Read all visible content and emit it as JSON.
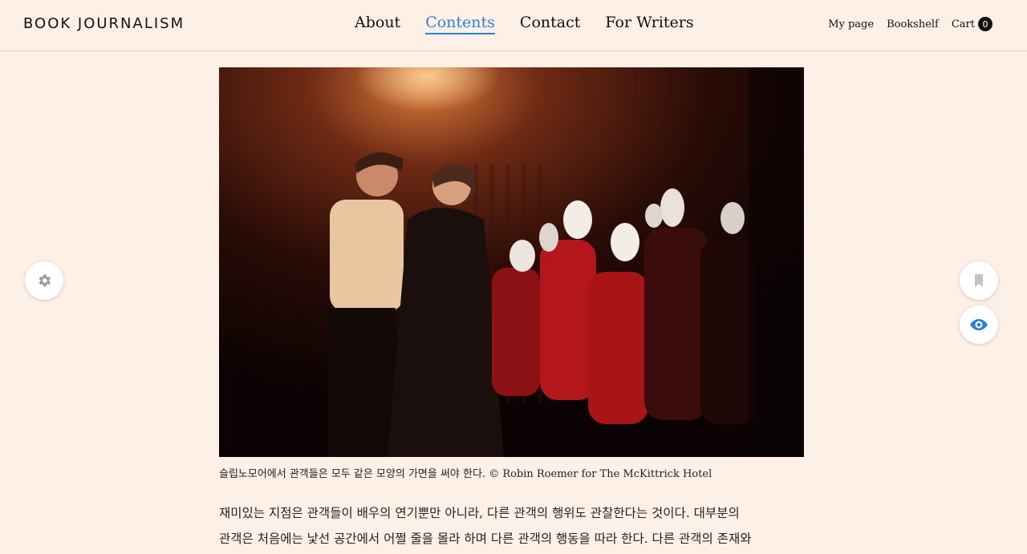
{
  "header": {
    "logo": "BOOK JOURNALISM",
    "nav": [
      {
        "label": "About"
      },
      {
        "label": "Contents",
        "active": true
      },
      {
        "label": "Contact"
      },
      {
        "label": "For Writers"
      }
    ],
    "util": {
      "mypage": "My page",
      "bookshelf": "Bookshelf",
      "cart_label": "Cart",
      "cart_count": "0"
    }
  },
  "article": {
    "caption": "슬립노모어에서 관객들은 모두 같은 모양의 가면을 써야 한다. © Robin Roemer for The McKittrick Hotel",
    "paragraph_lines": [
      "재미있는 지점은 관객들이 배우의 연기뿐만 아니라, 다른 관객의 행위도 관찰한다는 것이다. 대부분의",
      "관객은 처음에는 낯선 공간에서 어쩔 줄을 몰라 하며 다른 관객의 행동을 따라 한다. 다른 관객의 존재와"
    ]
  },
  "icons": {
    "settings": "gear-icon",
    "bookmark": "bookmark-icon",
    "view": "eye-icon"
  },
  "colors": {
    "background": "#fdf0e6",
    "accent": "#2f7fd8",
    "text": "#111111"
  }
}
